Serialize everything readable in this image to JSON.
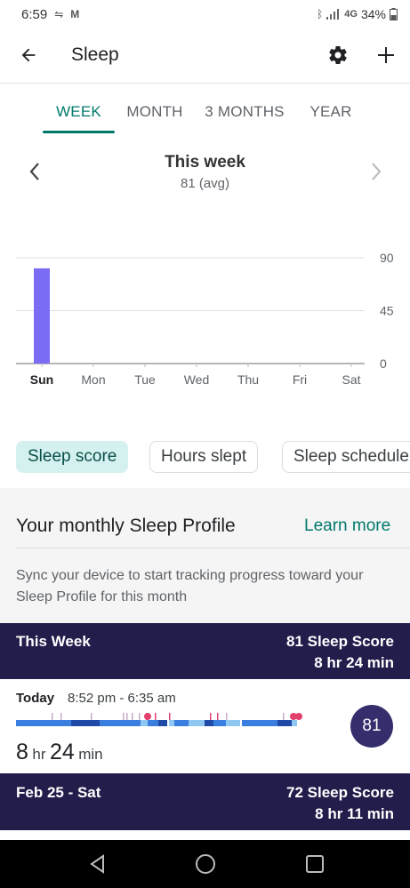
{
  "status_bar": {
    "time": "6:59",
    "battery": "34%",
    "network": "4G"
  },
  "app_bar": {
    "title": "Sleep",
    "back_icon": "arrow-left-icon",
    "settings_icon": "gear-icon",
    "add_icon": "plus-icon"
  },
  "tabs": [
    {
      "label": "WEEK",
      "active": true
    },
    {
      "label": "MONTH",
      "active": false
    },
    {
      "label": "3 MONTHS",
      "active": false
    },
    {
      "label": "YEAR",
      "active": false
    }
  ],
  "period": {
    "title": "This week",
    "subtitle": "81 (avg)"
  },
  "chart_data": {
    "type": "bar",
    "categories": [
      "Sun",
      "Mon",
      "Tue",
      "Wed",
      "Thu",
      "Fri",
      "Sat"
    ],
    "values": [
      81,
      null,
      null,
      null,
      null,
      null,
      null
    ],
    "highlight_category": "Sun",
    "yticks": [
      0,
      45,
      90
    ],
    "ylim": [
      0,
      90
    ],
    "bar_color": "#7b6cf6",
    "grid": true
  },
  "chips": [
    {
      "label": "Sleep score",
      "active": true
    },
    {
      "label": "Hours slept",
      "active": false
    },
    {
      "label": "Sleep schedule",
      "active": false
    }
  ],
  "profile": {
    "title": "Your monthly Sleep Profile",
    "learn_more": "Learn more",
    "description": "Sync your device to start tracking progress toward your Sleep Profile for this month"
  },
  "week_summary": {
    "label": "This Week",
    "score": "81 Sleep Score",
    "duration": "8 hr 24 min"
  },
  "today": {
    "label": "Today",
    "time_range": "8:52 pm - 6:35 am",
    "hours": "8",
    "hours_unit": "hr",
    "minutes": "24",
    "minutes_unit": "min",
    "score": "81"
  },
  "previous_day": {
    "label": "Feb 25 - Sat",
    "score": "72 Sleep Score",
    "duration": "8 hr 11 min"
  },
  "colors": {
    "accent": "#00796b",
    "header_dark": "#231d4b",
    "score_circle": "#342f6c",
    "chip_active": "#d4f1ef",
    "deep": "#1f4aa8",
    "light": "#3a7fe0",
    "rem": "#8ec7f2",
    "awake": "#e3406e"
  }
}
